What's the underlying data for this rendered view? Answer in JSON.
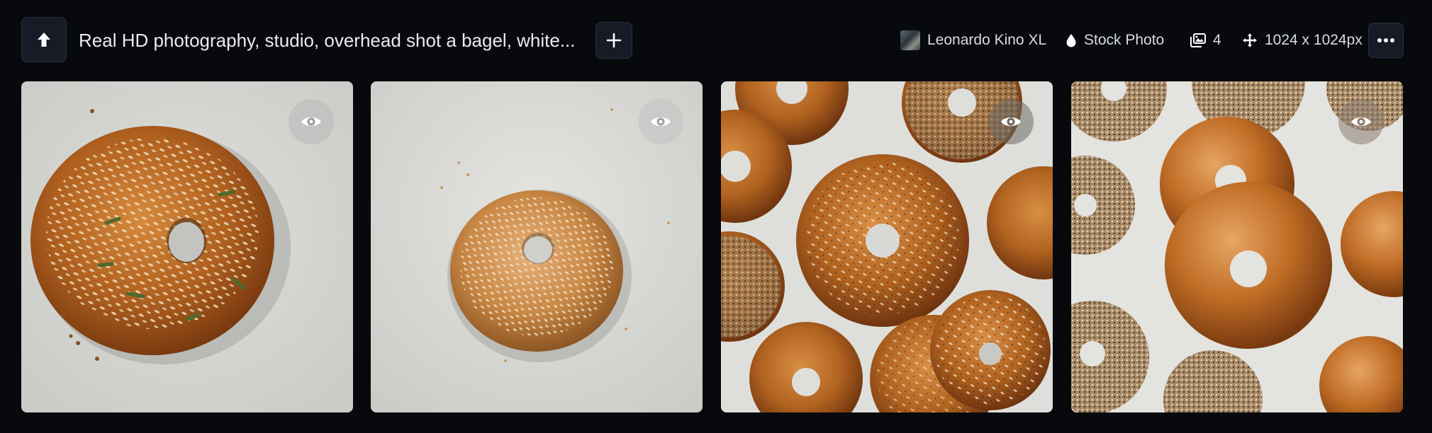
{
  "header": {
    "prompt": "Real HD photography, studio, overhead shot a bagel, white...",
    "upload_icon": "arrow-up-icon",
    "add_icon": "plus-icon",
    "more_icon": "ellipsis-horizontal-icon"
  },
  "meta": {
    "model": "Leonardo Kino XL",
    "style": "Stock Photo",
    "count": "4",
    "dimensions": "1024 x 1024px"
  },
  "images": [
    {
      "visibility_icon": "eye-icon",
      "subject": "single seeded bagel"
    },
    {
      "visibility_icon": "eye-icon",
      "subject": "single sesame bagel"
    },
    {
      "visibility_icon": "eye-icon",
      "subject": "many bagels pattern"
    },
    {
      "visibility_icon": "eye-icon",
      "subject": "many glossy bagels"
    }
  ],
  "colors": {
    "background": "#07090d",
    "button_bg": "#161b26",
    "button_border": "#2a3140",
    "text": "#e6e8ee"
  }
}
